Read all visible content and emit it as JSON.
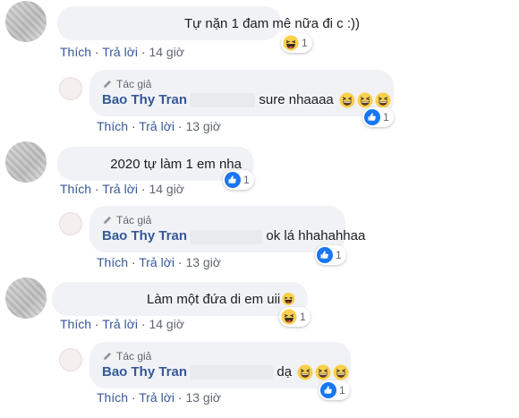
{
  "actions": {
    "like": "Thích",
    "reply": "Trả lời",
    "dot": "·"
  },
  "author_badge": "Tác giả",
  "comments": [
    {
      "text": "Tự nặn 1 đam mê nữa đi c :))",
      "time": "14 giờ",
      "reaction": "haha",
      "count": "1"
    },
    {
      "name": "Bao Thy Tran",
      "text": "sure nhaaaa",
      "emoji_count": 3,
      "time": "13 giờ",
      "reaction": "like",
      "count": "1"
    },
    {
      "text": "2020 tự làm 1 em nha",
      "time": "14 giờ",
      "reaction": "like",
      "count": "1"
    },
    {
      "name": "Bao Thy Tran",
      "text": "ok lá hhahahhaa",
      "time": "13 giờ",
      "reaction": "like",
      "count": "1"
    },
    {
      "text": "Làm một đứa di em uii",
      "time": "14 giờ",
      "reaction": "haha",
      "count": "1"
    },
    {
      "name": "Bao Thy Tran",
      "text": "dạ",
      "emoji_count": 3,
      "time": "13 giờ",
      "reaction": "like",
      "count": "1"
    }
  ]
}
